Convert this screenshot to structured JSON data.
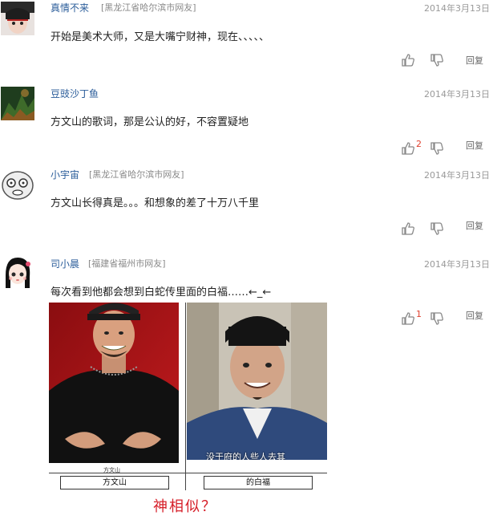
{
  "comments": [
    {
      "name": "真情不来",
      "location": "[黑龙江省哈尔滨市网友]",
      "date": "2014年3月13日",
      "text": "开始是美术大师，又是大嘴宁财神，现在、、、、、",
      "likes": "",
      "reply": "回复"
    },
    {
      "name": "豆豉沙丁鱼",
      "location": "",
      "date": "2014年3月13日",
      "text": "方文山的歌词，那是公认的好，不容置疑地",
      "likes": "2",
      "reply": "回复"
    },
    {
      "name": "小宇宙",
      "location": "[黑龙江省哈尔滨市网友]",
      "date": "2014年3月13日",
      "text": "方文山长得真是。。。和想象的差了十万八千里",
      "likes": "",
      "reply": "回复"
    },
    {
      "name": "司小晨",
      "location": "[福建省福州市网友]",
      "date": "2014年3月13日",
      "text": "每次看到他都会想到白蛇传里面的白福……←_←",
      "likes": "1",
      "reply": "回复"
    }
  ],
  "image": {
    "left_small_caption": "方文山",
    "left_caption": "方文山",
    "right_caption": "的白福",
    "subtitle_text": "没于府的人些人去其",
    "handwritten_note": "神相似？"
  },
  "colors": {
    "name": "#2b5d9a",
    "meta": "#999999",
    "count": "#e0412f",
    "handwritten": "#d6202a"
  },
  "icons": [
    "thumbs-up-icon",
    "thumbs-down-icon"
  ]
}
